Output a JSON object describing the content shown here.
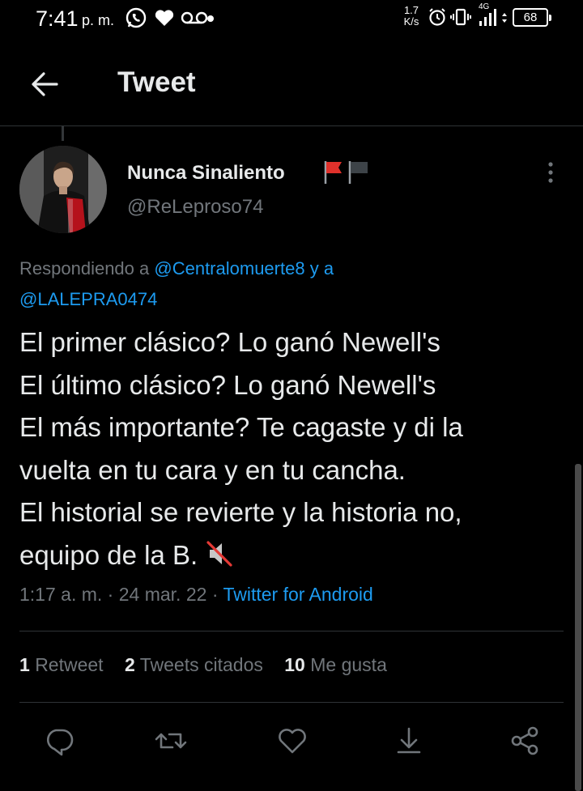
{
  "status_bar": {
    "time": "7:41",
    "ampm": "p. m.",
    "speed_value": "1.7",
    "speed_unit": "K/s",
    "network": "4G",
    "battery": "68"
  },
  "header": {
    "title": "Tweet"
  },
  "author": {
    "name": "Nunca Sinaliento",
    "handle": "@ReLeproso74",
    "flags": [
      "red-flag",
      "black-flag"
    ]
  },
  "reply": {
    "prefix": "Respondiendo a",
    "user1": "@Centralomuerte8",
    "conjunction": "y a",
    "user2": "@LALEPRA0474"
  },
  "tweet": {
    "lines": [
      "El primer clásico? Lo ganó Newell's",
      "El último clásico? Lo ganó Newell's",
      "El más importante? Te cagaste y di la",
      "vuelta en tu cara y en tu cancha.",
      "El historial se revierte y la historia no,",
      "equipo de la B."
    ],
    "emoji": "muted-speaker"
  },
  "meta": {
    "time": "1:17 a. m.",
    "separator": "·",
    "date": "24 mar. 22",
    "source": "Twitter for Android"
  },
  "stats": {
    "retweets_count": "1",
    "retweets_label": "Retweet",
    "quotes_count": "2",
    "quotes_label": "Tweets citados",
    "likes_count": "10",
    "likes_label": "Me gusta"
  },
  "actions": [
    "reply-icon",
    "retweet-icon",
    "like-icon",
    "share-icon",
    "share-network-icon"
  ],
  "colors": {
    "background": "#000000",
    "text": "#e7e9ea",
    "secondary": "#71767b",
    "link": "#1d9bf0",
    "divider": "#2f3336"
  }
}
